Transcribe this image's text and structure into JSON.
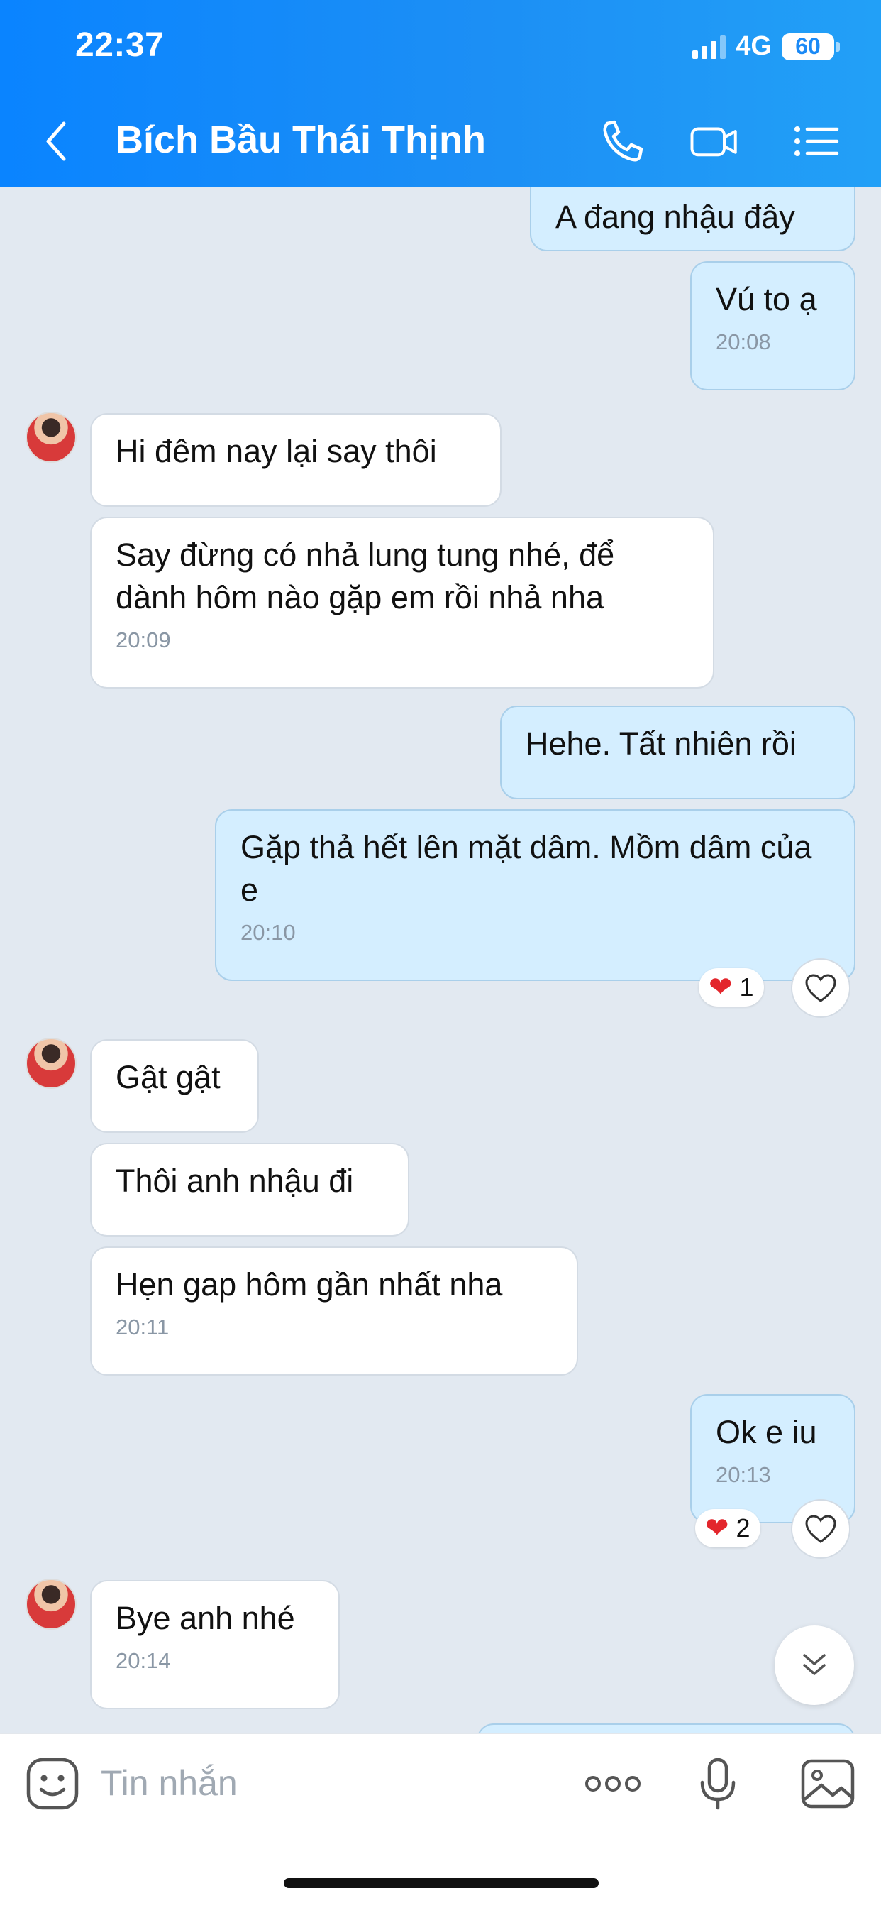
{
  "status_bar": {
    "time": "22:37",
    "network": "4G",
    "battery": "60"
  },
  "header": {
    "title": "Bích Bầu Thái Thịnh",
    "icons": [
      "back-icon",
      "phone-icon",
      "video-icon",
      "menu-icon"
    ]
  },
  "messages": [
    {
      "from": "me",
      "text": "A đang nhậu đây",
      "time": ""
    },
    {
      "from": "me",
      "text": "Vú to ạ",
      "time": "20:08"
    },
    {
      "from": "them",
      "text": "Hi đêm nay lại say thôi",
      "time": ""
    },
    {
      "from": "them",
      "text": "Say đừng có nhả lung tung nhé, để dành hôm nào gặp em rồi nhả nha",
      "time": "20:09"
    },
    {
      "from": "me",
      "text": "Hehe. Tất nhiên rồi",
      "time": ""
    },
    {
      "from": "me",
      "text": "Gặp thả hết lên mặt dâm. Mồm dâm của e",
      "time": "20:10",
      "reaction_count": "1"
    },
    {
      "from": "them",
      "text": "Gật gật",
      "time": ""
    },
    {
      "from": "them",
      "text": "Thôi anh nhậu đi",
      "time": ""
    },
    {
      "from": "them",
      "text": "Hẹn gap hôm gần nhất nha",
      "time": "20:11"
    },
    {
      "from": "me",
      "text": "Ok e iu",
      "time": "20:13",
      "reaction_count": "2"
    },
    {
      "from": "them",
      "text": "Bye anh nhé",
      "time": "20:14"
    }
  ],
  "composer": {
    "placeholder": "Tin nhắn",
    "icons": [
      "sticker-icon",
      "more-icon",
      "mic-icon",
      "image-icon"
    ]
  },
  "colors": {
    "header": "#0a84ff",
    "my_bubble": "#d4eeff",
    "their_bubble": "#ffffff",
    "background": "#e2e9f1",
    "reaction_heart": "#e3262c"
  }
}
